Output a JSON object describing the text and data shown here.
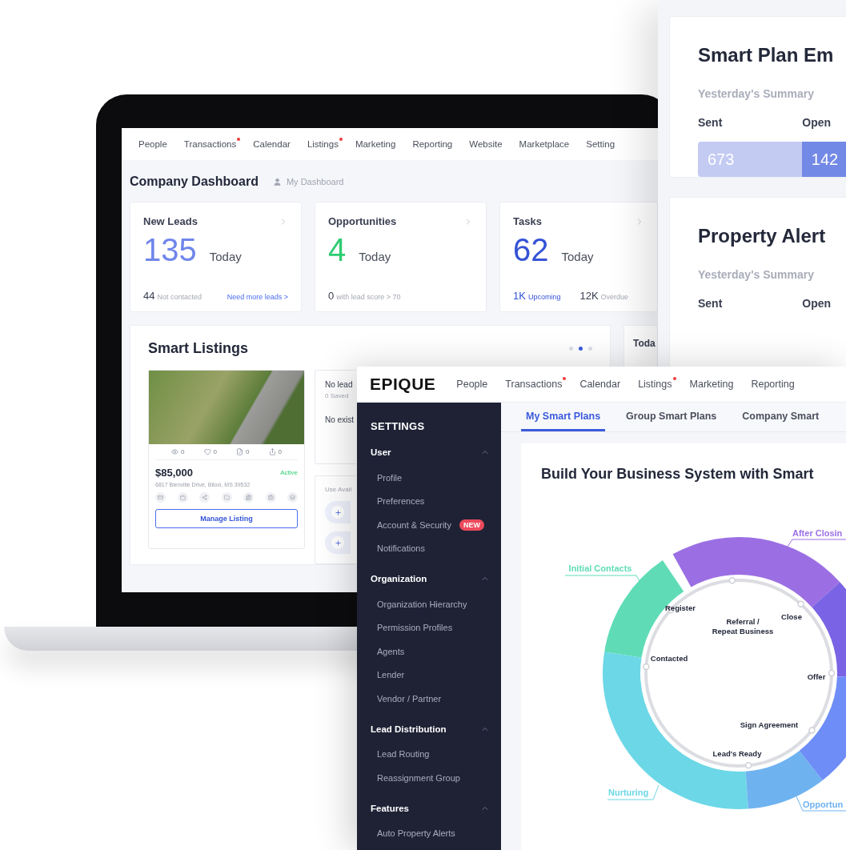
{
  "laptop": {
    "nav": [
      {
        "label": "People",
        "alert": false
      },
      {
        "label": "Transactions",
        "alert": true
      },
      {
        "label": "Calendar",
        "alert": false
      },
      {
        "label": "Listings",
        "alert": true
      },
      {
        "label": "Marketing",
        "alert": false
      },
      {
        "label": "Reporting",
        "alert": false
      },
      {
        "label": "Website",
        "alert": false
      },
      {
        "label": "Marketplace",
        "alert": false
      },
      {
        "label": "Setting",
        "alert": false
      }
    ],
    "dashboard_title": "Company Dashboard",
    "dashboard_switch": "My Dashboard",
    "stats": [
      {
        "title": "New Leads",
        "value": "135",
        "color": "#6f86ea",
        "period": "Today",
        "footer": [
          {
            "value": "44",
            "label": "Not contacted",
            "accent": false
          }
        ],
        "link": "Need more leads >"
      },
      {
        "title": "Opportunities",
        "value": "4",
        "color": "#2ecc71",
        "period": "Today",
        "footer": [
          {
            "value": "0",
            "label": "with lead score > 70",
            "accent": false
          }
        ]
      },
      {
        "title": "Tasks",
        "value": "62",
        "color": "#3553d6",
        "period": "Today",
        "footer": [
          {
            "value": "1K",
            "label": "Upcoming",
            "accent": true
          },
          {
            "value": "12K",
            "label": "Overdue",
            "accent": false
          }
        ]
      }
    ],
    "smart_listings": {
      "title": "Smart Listings",
      "pager": [
        {
          "selected": false
        },
        {
          "selected": true
        },
        {
          "selected": false
        }
      ],
      "listing": {
        "stats": [
          {
            "kind": "views",
            "value": "0"
          },
          {
            "kind": "likes",
            "value": "0"
          },
          {
            "kind": "docs",
            "value": "0"
          },
          {
            "kind": "shares",
            "value": "0"
          }
        ],
        "price": "$85,000",
        "status": "Active",
        "address": "6817 Bienville Drive, Biloxi, MS 39532",
        "button": "Manage Listing"
      },
      "leads_card": [
        {
          "kind": "title",
          "text": "No lead"
        },
        {
          "kind": "note",
          "text": "0 Saved"
        },
        {
          "kind": "title",
          "text": "No exist"
        }
      ],
      "suggest": {
        "label": "Use Avail"
      }
    },
    "side_card_title": "Toda"
  },
  "right_panel": {
    "cards": [
      {
        "title": "Smart Plan Em",
        "subtitle": "Yesterday's Summary",
        "columns": [
          "Sent",
          "Open"
        ],
        "bar": [
          "673",
          "142"
        ]
      },
      {
        "title": "Property Alert",
        "subtitle": "Yesterday's Summary",
        "columns": [
          "Sent",
          "Open"
        ]
      }
    ]
  },
  "settings_window": {
    "logo": "EPIQUE",
    "nav": [
      {
        "label": "People",
        "alert": false
      },
      {
        "label": "Transactions",
        "alert": true
      },
      {
        "label": "Calendar",
        "alert": false
      },
      {
        "label": "Listings",
        "alert": true
      },
      {
        "label": "Marketing",
        "alert": false
      },
      {
        "label": "Reporting",
        "alert": false
      }
    ],
    "sidebar": {
      "title": "SETTINGS",
      "groups": [
        {
          "label": "User",
          "expanded": true,
          "items": [
            {
              "label": "Profile"
            },
            {
              "label": "Preferences"
            },
            {
              "label": "Account & Security",
              "badge": "NEW"
            },
            {
              "label": "Notifications"
            }
          ]
        },
        {
          "label": "Organization",
          "expanded": true,
          "items": [
            {
              "label": "Organization Hierarchy"
            },
            {
              "label": "Permission Profiles"
            },
            {
              "label": "Agents"
            },
            {
              "label": "Lender"
            },
            {
              "label": "Vendor / Partner"
            }
          ]
        },
        {
          "label": "Lead Distribution",
          "expanded": true,
          "items": [
            {
              "label": "Lead Routing"
            },
            {
              "label": "Reassignment Group"
            }
          ]
        },
        {
          "label": "Features",
          "expanded": true,
          "items": [
            {
              "label": "Auto Property Alerts"
            }
          ]
        }
      ]
    },
    "tabs": [
      {
        "label": "My Smart Plans",
        "selected": true
      },
      {
        "label": "Group Smart Plans",
        "selected": false
      },
      {
        "label": "Company Smart",
        "selected": false
      }
    ],
    "heading": "Build Your Business System with Smart",
    "diagram": {
      "phases": [
        {
          "label": "Initial Contacts",
          "color": "#5fdcb6"
        },
        {
          "label": "After Closin",
          "color": "#9b6fe3"
        },
        {
          "label": "Nurturing",
          "color": "#6cd7e6"
        },
        {
          "label": "Opportun",
          "color": "#6fb2f0"
        }
      ],
      "steps": [
        {
          "lines": [
            "Register"
          ]
        },
        {
          "lines": [
            "Referral /",
            "Repeat Business"
          ]
        },
        {
          "lines": [
            "Close"
          ]
        },
        {
          "lines": [
            "Contacted"
          ]
        },
        {
          "lines": [
            "Offer"
          ]
        },
        {
          "lines": [
            "Sign Agreement"
          ]
        },
        {
          "lines": [
            "Lead's Ready"
          ]
        }
      ]
    }
  }
}
